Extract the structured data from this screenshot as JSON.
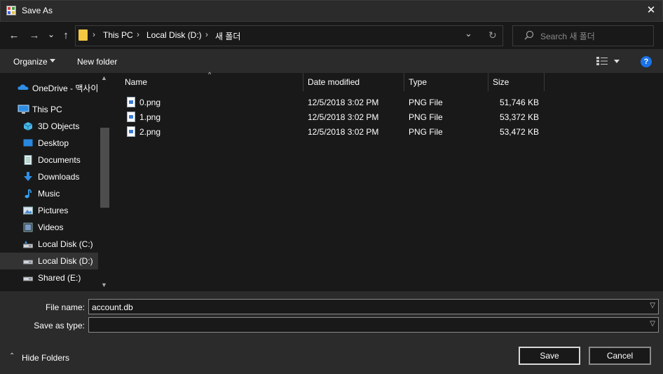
{
  "window": {
    "title": "Save As",
    "close_glyph": "✕"
  },
  "nav": {
    "back_glyph": "←",
    "forward_glyph": "→",
    "recent_glyph": "⌄",
    "up_glyph": "↑",
    "breadcrumbs": [
      "This PC",
      "Local Disk (D:)",
      "새 폴더"
    ],
    "separator": "›",
    "dropdown_glyph": "⌄",
    "refresh_glyph": "↻"
  },
  "search": {
    "placeholder": "Search 새 폴더"
  },
  "toolbar": {
    "organize_label": "Organize",
    "new_folder_label": "New folder",
    "help_glyph": "?"
  },
  "sidebar": {
    "items": [
      {
        "label": "OneDrive - 맥사이",
        "icon": "cloud-icon"
      },
      {
        "label": "This PC",
        "icon": "computer-icon"
      },
      {
        "label": "3D Objects",
        "icon": "cube-icon"
      },
      {
        "label": "Desktop",
        "icon": "desktop-icon"
      },
      {
        "label": "Documents",
        "icon": "document-icon"
      },
      {
        "label": "Downloads",
        "icon": "download-icon"
      },
      {
        "label": "Music",
        "icon": "music-icon"
      },
      {
        "label": "Pictures",
        "icon": "picture-icon"
      },
      {
        "label": "Videos",
        "icon": "video-icon"
      },
      {
        "label": "Local Disk (C:)",
        "icon": "drive-icon"
      },
      {
        "label": "Local Disk (D:)",
        "icon": "drive-icon"
      },
      {
        "label": "Shared (E:)",
        "icon": "drive-icon"
      }
    ],
    "selected": "Local Disk (D:)"
  },
  "file_list": {
    "columns": [
      "Name",
      "Date modified",
      "Type",
      "Size"
    ],
    "rows": [
      {
        "name": "0.png",
        "date": "12/5/2018 3:02 PM",
        "type": "PNG File",
        "size": "51,746 KB"
      },
      {
        "name": "1.png",
        "date": "12/5/2018 3:02 PM",
        "type": "PNG File",
        "size": "53,372 KB"
      },
      {
        "name": "2.png",
        "date": "12/5/2018 3:02 PM",
        "type": "PNG File",
        "size": "53,472 KB"
      }
    ]
  },
  "form": {
    "file_name_label": "File name:",
    "file_name_value": "account.db",
    "save_type_label": "Save as type:",
    "save_type_value": ""
  },
  "buttons": {
    "save_label": "Save",
    "cancel_label": "Cancel",
    "hide_folders_label": "Hide Folders",
    "hide_folders_glyph": "⌃"
  },
  "colors": {
    "background": "#191919",
    "panel": "#2b2b2b",
    "accent": "#1a73e8",
    "folder": "#f5c842"
  }
}
